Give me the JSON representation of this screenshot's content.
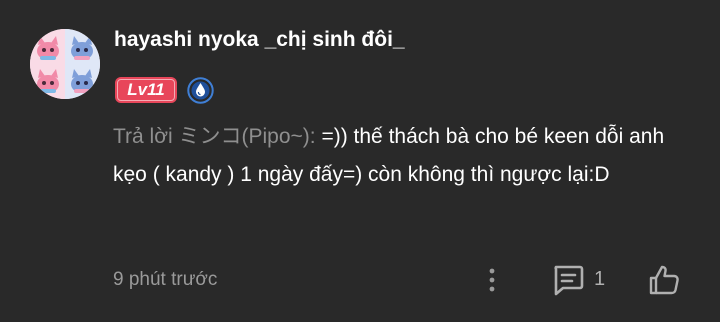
{
  "comment": {
    "author": {
      "avatar_icon": "four-cats-collage-avatar",
      "name": "hayashi nyoka _chị sinh đôi_",
      "level_badge": "Lv11",
      "level_badge_color": "#e8465a",
      "community_icon": "blue-circle-drop-icon"
    },
    "text": {
      "reply_prefix": "Trả lời ミンコ(Pipo~): ",
      "body": "=)) thế thách bà cho bé keen dỗi anh kẹo ( kandy ) 1 ngày đấy=) còn không thì ngược lại:D"
    },
    "footer": {
      "timestamp": "9 phút trước",
      "more_icon": "vertical-dots-icon",
      "reply_icon": "comment-bubble-icon",
      "reply_count": "1",
      "like_icon": "thumbs-up-icon"
    }
  },
  "colors": {
    "background": "#292929",
    "text_primary": "#ffffff",
    "text_muted": "#8f8f8f"
  }
}
